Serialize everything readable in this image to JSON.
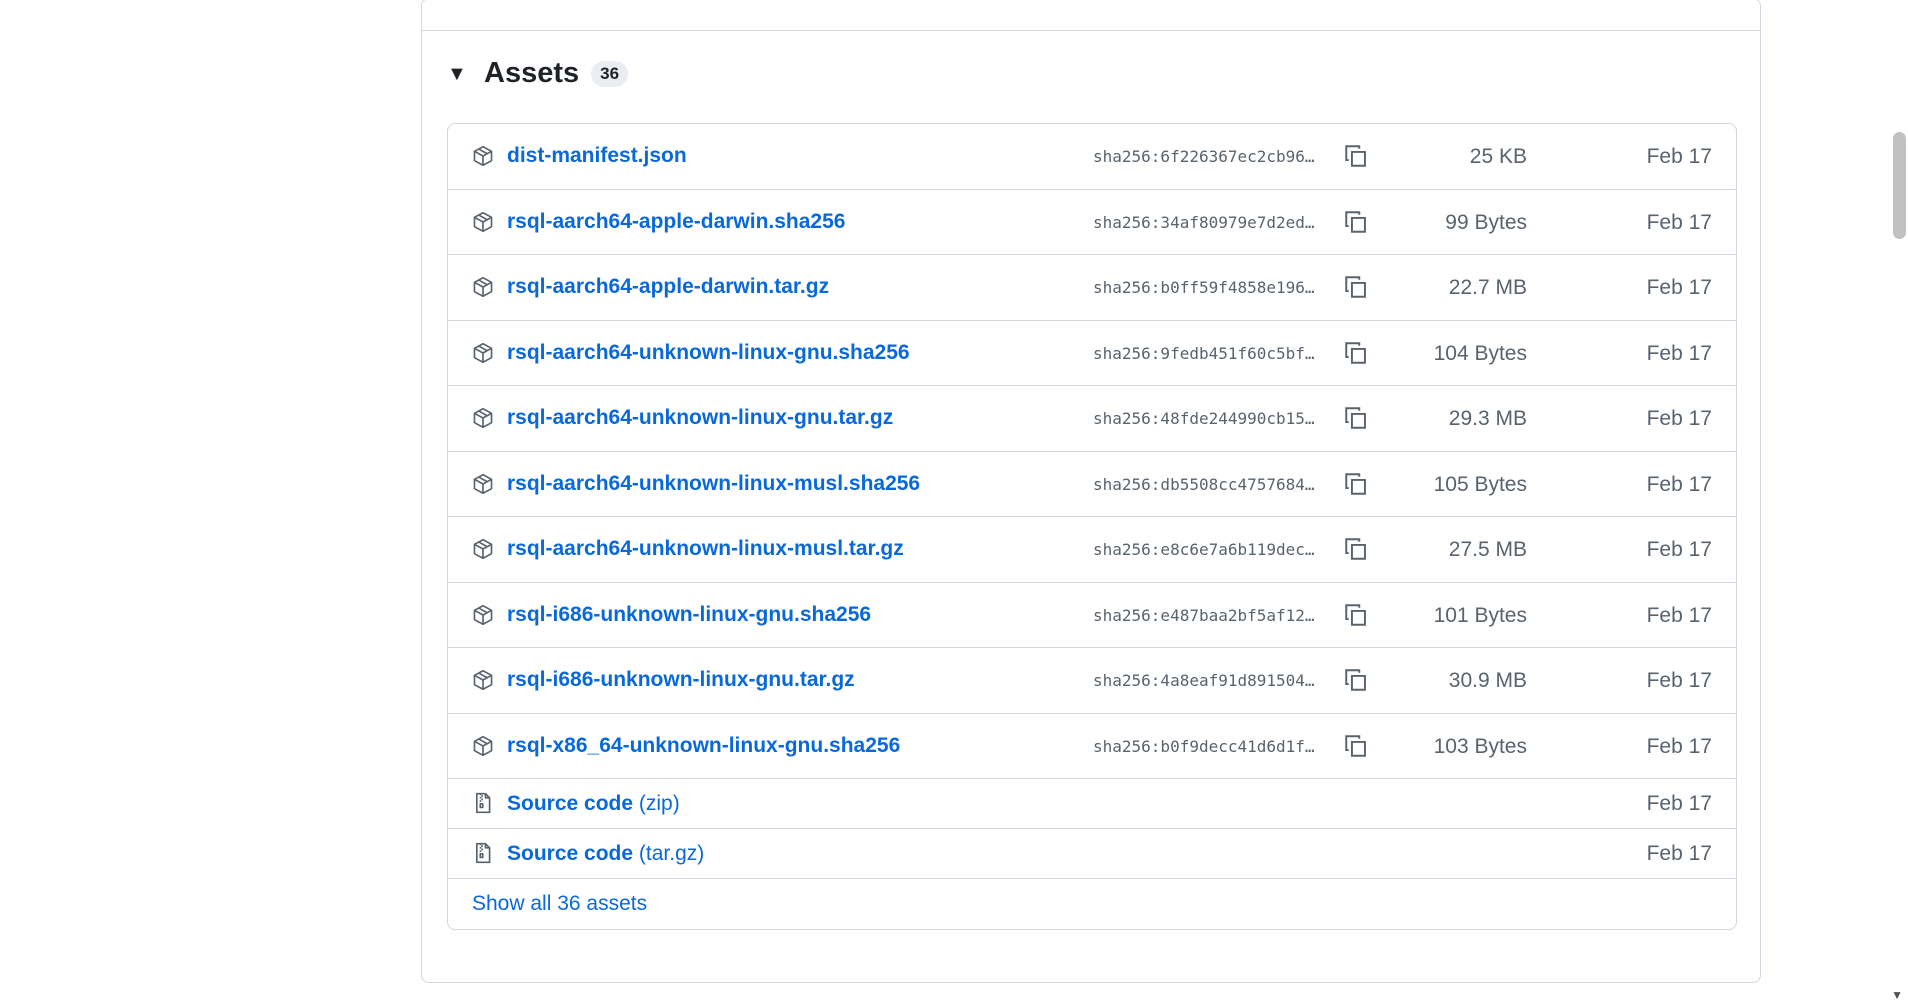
{
  "assets": {
    "title": "Assets",
    "count": "36",
    "rows": [
      {
        "name": "dist-manifest.json",
        "sha": "sha256:6f226367ec2cb96…",
        "size": "25 KB",
        "date": "Feb 17"
      },
      {
        "name": "rsql-aarch64-apple-darwin.sha256",
        "sha": "sha256:34af80979e7d2ed…",
        "size": "99 Bytes",
        "date": "Feb 17"
      },
      {
        "name": "rsql-aarch64-apple-darwin.tar.gz",
        "sha": "sha256:b0ff59f4858e196…",
        "size": "22.7 MB",
        "date": "Feb 17"
      },
      {
        "name": "rsql-aarch64-unknown-linux-gnu.sha256",
        "sha": "sha256:9fedb451f60c5bf…",
        "size": "104 Bytes",
        "date": "Feb 17"
      },
      {
        "name": "rsql-aarch64-unknown-linux-gnu.tar.gz",
        "sha": "sha256:48fde244990cb15…",
        "size": "29.3 MB",
        "date": "Feb 17"
      },
      {
        "name": "rsql-aarch64-unknown-linux-musl.sha256",
        "sha": "sha256:db5508cc4757684…",
        "size": "105 Bytes",
        "date": "Feb 17"
      },
      {
        "name": "rsql-aarch64-unknown-linux-musl.tar.gz",
        "sha": "sha256:e8c6e7a6b119dec…",
        "size": "27.5 MB",
        "date": "Feb 17"
      },
      {
        "name": "rsql-i686-unknown-linux-gnu.sha256",
        "sha": "sha256:e487baa2bf5af12…",
        "size": "101 Bytes",
        "date": "Feb 17"
      },
      {
        "name": "rsql-i686-unknown-linux-gnu.tar.gz",
        "sha": "sha256:4a8eaf91d891504…",
        "size": "30.9 MB",
        "date": "Feb 17"
      },
      {
        "name": "rsql-x86_64-unknown-linux-gnu.sha256",
        "sha": "sha256:b0f9decc41d6d1f…",
        "size": "103 Bytes",
        "date": "Feb 17"
      }
    ],
    "source": [
      {
        "label": "Source code",
        "suffix": "(zip)",
        "date": "Feb 17"
      },
      {
        "label": "Source code",
        "suffix": "(tar.gz)",
        "date": "Feb 17"
      }
    ],
    "show_all": "Show all 36 assets"
  },
  "icons": {
    "package": "package-icon",
    "zip": "file-zip-icon",
    "copy": "copy-icon",
    "toggle": "triangle-down-icon"
  },
  "colors": {
    "link": "#0969da",
    "muted": "#59636e",
    "border": "#d0d7de"
  }
}
